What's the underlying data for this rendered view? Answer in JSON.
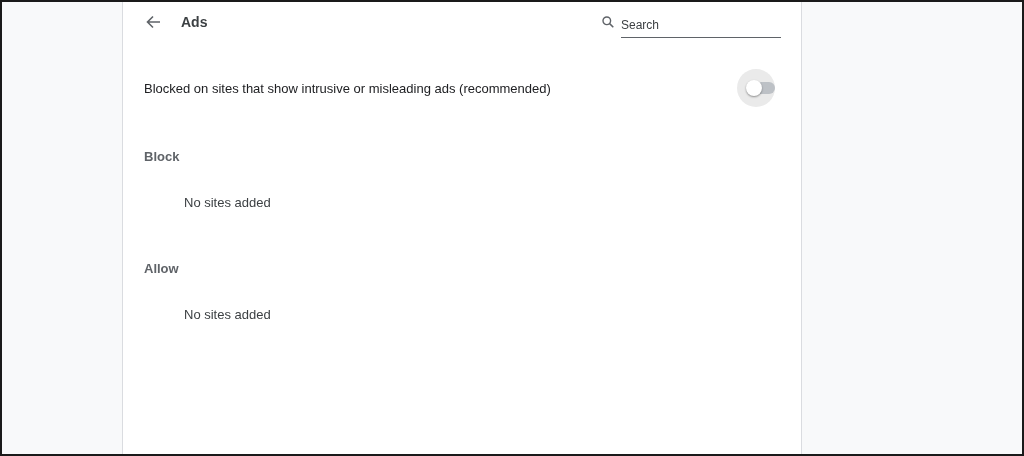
{
  "header": {
    "title": "Ads",
    "search": {
      "placeholder": "Search"
    }
  },
  "setting": {
    "label": "Blocked on sites that show intrusive or misleading ads (recommended)",
    "on": false
  },
  "sections": [
    {
      "heading": "Block",
      "empty_text": "No sites added"
    },
    {
      "heading": "Allow",
      "empty_text": "No sites added"
    }
  ]
}
